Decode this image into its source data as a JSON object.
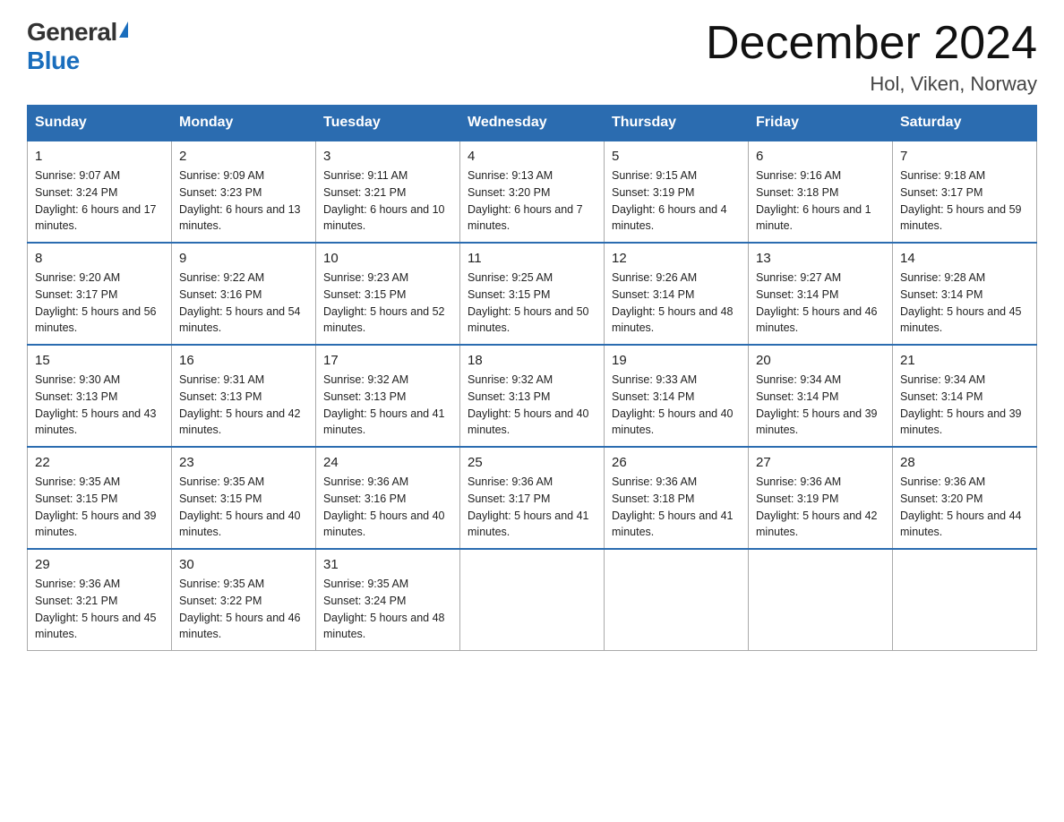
{
  "logo": {
    "general": "General",
    "blue": "Blue",
    "triangle": "▶"
  },
  "title": "December 2024",
  "subtitle": "Hol, Viken, Norway",
  "headers": [
    "Sunday",
    "Monday",
    "Tuesday",
    "Wednesday",
    "Thursday",
    "Friday",
    "Saturday"
  ],
  "weeks": [
    [
      {
        "day": "1",
        "sunrise": "9:07 AM",
        "sunset": "3:24 PM",
        "daylight": "6 hours and 17 minutes."
      },
      {
        "day": "2",
        "sunrise": "9:09 AM",
        "sunset": "3:23 PM",
        "daylight": "6 hours and 13 minutes."
      },
      {
        "day": "3",
        "sunrise": "9:11 AM",
        "sunset": "3:21 PM",
        "daylight": "6 hours and 10 minutes."
      },
      {
        "day": "4",
        "sunrise": "9:13 AM",
        "sunset": "3:20 PM",
        "daylight": "6 hours and 7 minutes."
      },
      {
        "day": "5",
        "sunrise": "9:15 AM",
        "sunset": "3:19 PM",
        "daylight": "6 hours and 4 minutes."
      },
      {
        "day": "6",
        "sunrise": "9:16 AM",
        "sunset": "3:18 PM",
        "daylight": "6 hours and 1 minute."
      },
      {
        "day": "7",
        "sunrise": "9:18 AM",
        "sunset": "3:17 PM",
        "daylight": "5 hours and 59 minutes."
      }
    ],
    [
      {
        "day": "8",
        "sunrise": "9:20 AM",
        "sunset": "3:17 PM",
        "daylight": "5 hours and 56 minutes."
      },
      {
        "day": "9",
        "sunrise": "9:22 AM",
        "sunset": "3:16 PM",
        "daylight": "5 hours and 54 minutes."
      },
      {
        "day": "10",
        "sunrise": "9:23 AM",
        "sunset": "3:15 PM",
        "daylight": "5 hours and 52 minutes."
      },
      {
        "day": "11",
        "sunrise": "9:25 AM",
        "sunset": "3:15 PM",
        "daylight": "5 hours and 50 minutes."
      },
      {
        "day": "12",
        "sunrise": "9:26 AM",
        "sunset": "3:14 PM",
        "daylight": "5 hours and 48 minutes."
      },
      {
        "day": "13",
        "sunrise": "9:27 AM",
        "sunset": "3:14 PM",
        "daylight": "5 hours and 46 minutes."
      },
      {
        "day": "14",
        "sunrise": "9:28 AM",
        "sunset": "3:14 PM",
        "daylight": "5 hours and 45 minutes."
      }
    ],
    [
      {
        "day": "15",
        "sunrise": "9:30 AM",
        "sunset": "3:13 PM",
        "daylight": "5 hours and 43 minutes."
      },
      {
        "day": "16",
        "sunrise": "9:31 AM",
        "sunset": "3:13 PM",
        "daylight": "5 hours and 42 minutes."
      },
      {
        "day": "17",
        "sunrise": "9:32 AM",
        "sunset": "3:13 PM",
        "daylight": "5 hours and 41 minutes."
      },
      {
        "day": "18",
        "sunrise": "9:32 AM",
        "sunset": "3:13 PM",
        "daylight": "5 hours and 40 minutes."
      },
      {
        "day": "19",
        "sunrise": "9:33 AM",
        "sunset": "3:14 PM",
        "daylight": "5 hours and 40 minutes."
      },
      {
        "day": "20",
        "sunrise": "9:34 AM",
        "sunset": "3:14 PM",
        "daylight": "5 hours and 39 minutes."
      },
      {
        "day": "21",
        "sunrise": "9:34 AM",
        "sunset": "3:14 PM",
        "daylight": "5 hours and 39 minutes."
      }
    ],
    [
      {
        "day": "22",
        "sunrise": "9:35 AM",
        "sunset": "3:15 PM",
        "daylight": "5 hours and 39 minutes."
      },
      {
        "day": "23",
        "sunrise": "9:35 AM",
        "sunset": "3:15 PM",
        "daylight": "5 hours and 40 minutes."
      },
      {
        "day": "24",
        "sunrise": "9:36 AM",
        "sunset": "3:16 PM",
        "daylight": "5 hours and 40 minutes."
      },
      {
        "day": "25",
        "sunrise": "9:36 AM",
        "sunset": "3:17 PM",
        "daylight": "5 hours and 41 minutes."
      },
      {
        "day": "26",
        "sunrise": "9:36 AM",
        "sunset": "3:18 PM",
        "daylight": "5 hours and 41 minutes."
      },
      {
        "day": "27",
        "sunrise": "9:36 AM",
        "sunset": "3:19 PM",
        "daylight": "5 hours and 42 minutes."
      },
      {
        "day": "28",
        "sunrise": "9:36 AM",
        "sunset": "3:20 PM",
        "daylight": "5 hours and 44 minutes."
      }
    ],
    [
      {
        "day": "29",
        "sunrise": "9:36 AM",
        "sunset": "3:21 PM",
        "daylight": "5 hours and 45 minutes."
      },
      {
        "day": "30",
        "sunrise": "9:35 AM",
        "sunset": "3:22 PM",
        "daylight": "5 hours and 46 minutes."
      },
      {
        "day": "31",
        "sunrise": "9:35 AM",
        "sunset": "3:24 PM",
        "daylight": "5 hours and 48 minutes."
      },
      null,
      null,
      null,
      null
    ]
  ]
}
